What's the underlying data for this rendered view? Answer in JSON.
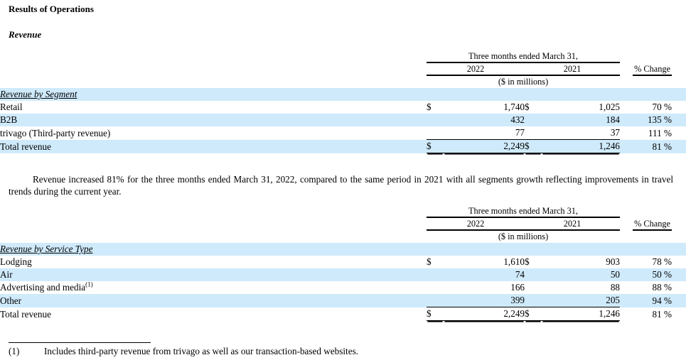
{
  "document": {
    "results_title": "Results of Operations",
    "revenue_title": "Revenue"
  },
  "colors": {
    "row_highlight": "#cfeafb",
    "text": "#000000",
    "rule": "#000000"
  },
  "table_segment": {
    "header": {
      "period_span": "Three months ended March 31,",
      "year_current": "2022",
      "year_prior": "2021",
      "pct_change": "% Change",
      "units": "($ in millions)"
    },
    "group_label": "Revenue by Segment",
    "currency_symbol": "$",
    "rows": [
      {
        "label": "Retail",
        "cur_2022": "$",
        "val_2022": "1,740",
        "cur_2021": "$",
        "val_2021": "1,025",
        "pct": "70 %"
      },
      {
        "label": "B2B",
        "cur_2022": "",
        "val_2022": "432",
        "cur_2021": "",
        "val_2021": "184",
        "pct": "135 %"
      },
      {
        "label": "trivago (Third-party revenue)",
        "cur_2022": "",
        "val_2022": "77",
        "cur_2021": "",
        "val_2021": "37",
        "pct": "111 %"
      }
    ],
    "total": {
      "label": "Total revenue",
      "cur_2022": "$",
      "val_2022": "2,249",
      "cur_2021": "$",
      "val_2021": "1,246",
      "pct": "81 %"
    }
  },
  "narrative": "Revenue increased 81% for the three months ended March 31, 2022, compared to the same period in 2021 with all segments growth reflecting improvements in travel trends during the current year.",
  "table_service": {
    "header": {
      "period_span": "Three months ended March 31,",
      "year_current": "2022",
      "year_prior": "2021",
      "pct_change": "% Change",
      "units": "($ in millions)"
    },
    "group_label": "Revenue by Service Type",
    "rows": [
      {
        "label": "Lodging",
        "footnote": "",
        "cur_2022": "$",
        "val_2022": "1,610",
        "cur_2021": "$",
        "val_2021": "903",
        "pct": "78 %"
      },
      {
        "label": "Air",
        "footnote": "",
        "cur_2022": "",
        "val_2022": "74",
        "cur_2021": "",
        "val_2021": "50",
        "pct": "50 %"
      },
      {
        "label": "Advertising and media",
        "footnote": "(1)",
        "cur_2022": "",
        "val_2022": "166",
        "cur_2021": "",
        "val_2021": "88",
        "pct": "88 %"
      },
      {
        "label": "Other",
        "footnote": "",
        "cur_2022": "",
        "val_2022": "399",
        "cur_2021": "",
        "val_2021": "205",
        "pct": "94 %"
      }
    ],
    "total": {
      "label": "Total revenue",
      "cur_2022": "$",
      "val_2022": "2,249",
      "cur_2021": "$",
      "val_2021": "1,246",
      "pct": "81 %"
    }
  },
  "footnote": {
    "marker": "(1)",
    "text": "Includes third-party revenue from trivago as well as our transaction-based websites."
  }
}
